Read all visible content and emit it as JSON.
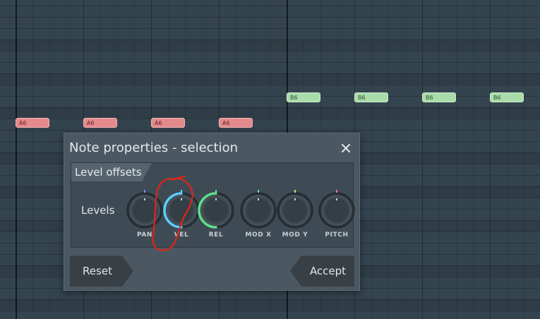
{
  "piano_roll": {
    "notes_row_a6": [
      "A6",
      "A6",
      "A6",
      "A6"
    ],
    "notes_row_b6": [
      "B6",
      "B6",
      "B6",
      "B6"
    ],
    "colors": {
      "a6_note": "#e58a8c",
      "b6_note": "#a9dcaa",
      "grid_bg": "#34444f"
    }
  },
  "dialog": {
    "title": "Note properties - selection",
    "close_icon": "close-icon",
    "section_title": "Level offsets",
    "row_label": "Levels",
    "knobs": [
      {
        "label": "PAN",
        "indicator_color": "#7a8cff",
        "arc": null
      },
      {
        "label": "VEL",
        "indicator_color": "#5ad0ff",
        "arc": "left",
        "arc_color": "#5ad0ff"
      },
      {
        "label": "REL",
        "indicator_color": "#5fe08a",
        "arc": "left",
        "arc_color": "#5fe08a"
      },
      {
        "label": "MOD X",
        "indicator_color": "#5fe08a",
        "arc": null
      },
      {
        "label": "MOD Y",
        "indicator_color": "#d4e05f",
        "arc": null
      },
      {
        "label": "PITCH",
        "indicator_color": "#ff6b8a",
        "arc": null
      }
    ],
    "reset_label": "Reset",
    "accept_label": "Accept"
  },
  "annotation": {
    "color": "#e0241b",
    "shape": "freehand-loop-around-vel-knob"
  }
}
